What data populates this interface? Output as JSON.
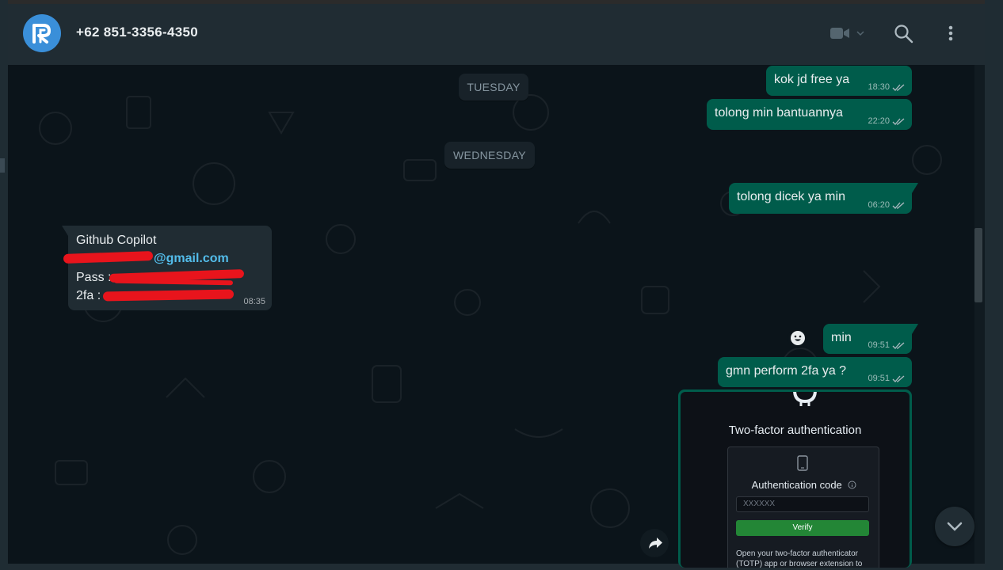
{
  "header": {
    "contact_name": "+62 851-3356-4350"
  },
  "days": {
    "tuesday": "TUESDAY",
    "wednesday": "WEDNESDAY"
  },
  "messages": [
    {
      "text": "kok jd free ya",
      "time": "18:30"
    },
    {
      "text": "tolong min bantuannya",
      "time": "22:20"
    },
    {
      "text": "tolong dicek ya min",
      "time": "06:20"
    },
    {
      "text": "min",
      "time": "09:51"
    },
    {
      "text": "gmn perform 2fa ya ?",
      "time": "09:51"
    }
  ],
  "incoming": {
    "title": "Github Copilot",
    "email_visible": "@gmail.com",
    "pass_label": "Pass :",
    "twofa_label": "2fa :",
    "time": "08:35"
  },
  "image_message": {
    "title": "Two-factor authentication",
    "auth_label": "Authentication code",
    "input_placeholder": "XXXXXX",
    "verify_label": "Verify",
    "help_text": "Open your two-factor authenticator (TOTP) app or browser extension to view"
  },
  "colors": {
    "outgoing_bubble": "#005c4b",
    "incoming_bubble": "#202c33",
    "chat_background": "#0b141a",
    "link": "#53bdeb",
    "redaction": "#e8141c"
  }
}
